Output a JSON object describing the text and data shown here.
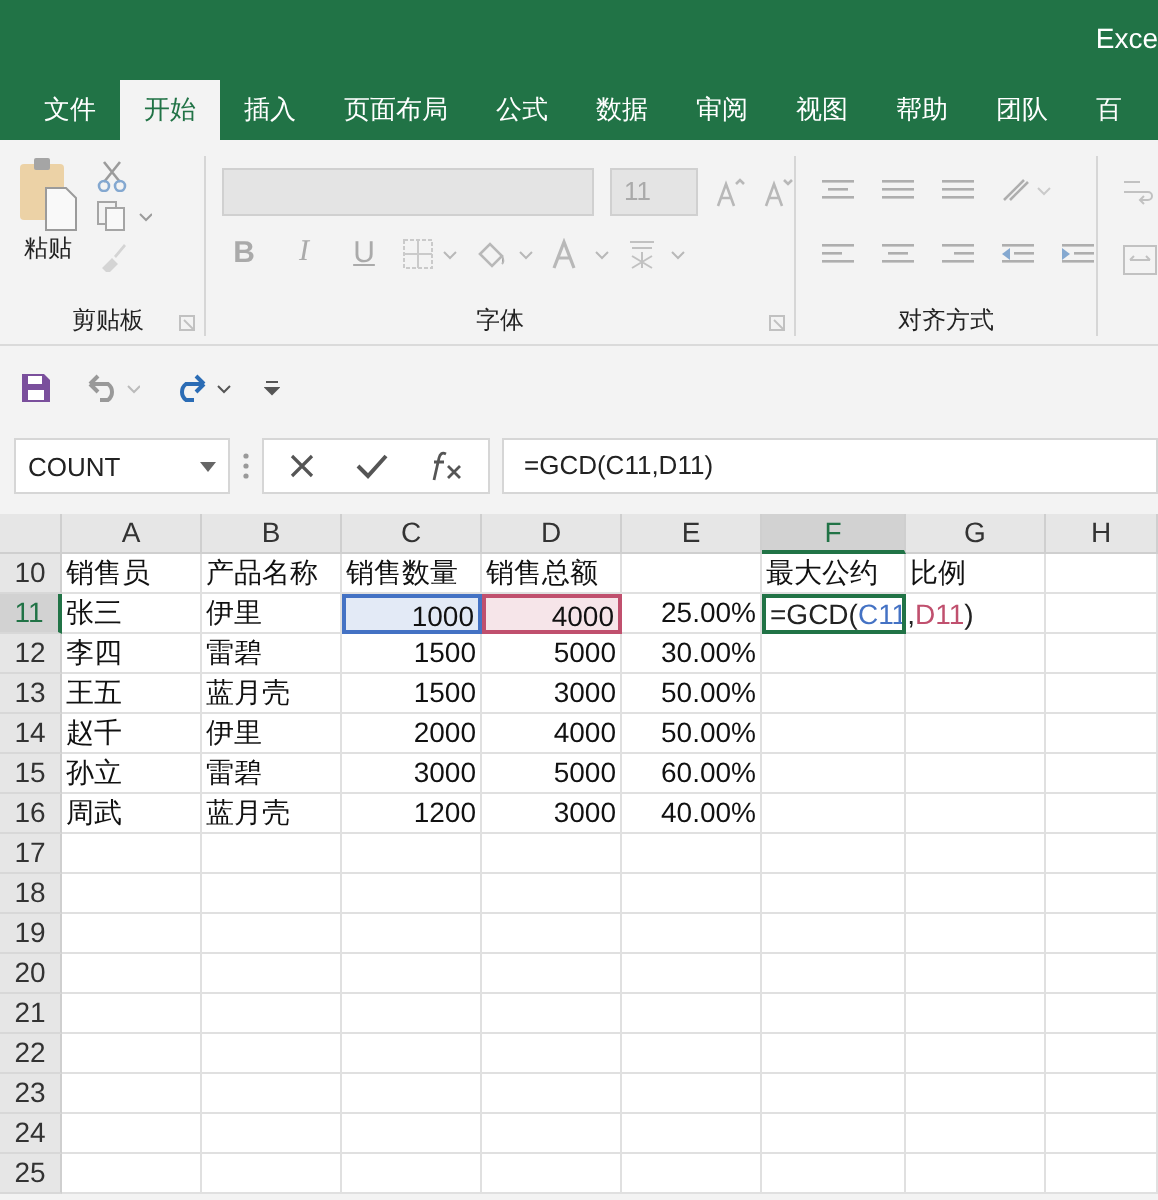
{
  "window": {
    "title": "Exce"
  },
  "tabs": [
    {
      "label": "文件",
      "selected": false
    },
    {
      "label": "开始",
      "selected": true
    },
    {
      "label": "插入",
      "selected": false
    },
    {
      "label": "页面布局",
      "selected": false
    },
    {
      "label": "公式",
      "selected": false
    },
    {
      "label": "数据",
      "selected": false
    },
    {
      "label": "审阅",
      "selected": false
    },
    {
      "label": "视图",
      "selected": false
    },
    {
      "label": "帮助",
      "selected": false
    },
    {
      "label": "团队",
      "selected": false
    },
    {
      "label": "百",
      "selected": false
    }
  ],
  "ribbon": {
    "disabled": true,
    "groups": [
      {
        "kind": "clipboard",
        "label": "剪贴板",
        "paste_label": "粘贴"
      },
      {
        "kind": "font",
        "label": "字体",
        "font_size": "11",
        "buttons": [
          "B",
          "I",
          "U"
        ]
      },
      {
        "kind": "alignment",
        "label": "对齐方式"
      }
    ]
  },
  "formula_bar": {
    "name_box": "COUNT",
    "formula": "=GCD(C11,D11)"
  },
  "sheet": {
    "columns": [
      {
        "label": "A",
        "selected": false
      },
      {
        "label": "B",
        "selected": false
      },
      {
        "label": "C",
        "selected": false
      },
      {
        "label": "D",
        "selected": false
      },
      {
        "label": "E",
        "selected": false
      },
      {
        "label": "F",
        "selected": true
      },
      {
        "label": "G",
        "selected": false
      },
      {
        "label": "H",
        "selected": false
      }
    ],
    "rows": [
      {
        "number": "10",
        "selected": false,
        "cells": [
          {
            "text": "销售员"
          },
          {
            "text": "产品名称"
          },
          {
            "text": "销售数量"
          },
          {
            "text": "销售总额"
          },
          null,
          {
            "text": "最大公约"
          },
          {
            "text": "比例"
          },
          null
        ]
      },
      {
        "number": "11",
        "selected": true,
        "cells": [
          {
            "text": "张三"
          },
          {
            "text": "伊里"
          },
          {
            "text": "1000",
            "kind": "number",
            "color": "#4472c4"
          },
          {
            "text": "4000",
            "kind": "number",
            "color": "#c0506e"
          },
          {
            "text": "25.00%",
            "kind": "number"
          },
          {
            "active": true,
            "text": "=GCD(C11,D11)",
            "references": [
              {
                "color": "#4472c4"
              },
              {
                "color": "#c0506e"
              }
            ]
          },
          null,
          null
        ]
      },
      {
        "number": "12",
        "selected": false,
        "cells": [
          {
            "text": "李四"
          },
          {
            "text": "雷碧"
          },
          {
            "text": "1500",
            "kind": "number"
          },
          {
            "text": "5000",
            "kind": "number"
          },
          {
            "text": "30.00%",
            "kind": "number"
          },
          null,
          null,
          null
        ]
      },
      {
        "number": "13",
        "selected": false,
        "cells": [
          {
            "text": "王五"
          },
          {
            "text": "蓝月壳"
          },
          {
            "text": "1500",
            "kind": "number"
          },
          {
            "text": "3000",
            "kind": "number"
          },
          {
            "text": "50.00%",
            "kind": "number"
          },
          null,
          null,
          null
        ]
      },
      {
        "number": "14",
        "selected": false,
        "cells": [
          {
            "text": "赵千"
          },
          {
            "text": "伊里"
          },
          {
            "text": "2000",
            "kind": "number"
          },
          {
            "text": "4000",
            "kind": "number"
          },
          {
            "text": "50.00%",
            "kind": "number"
          },
          null,
          null,
          null
        ]
      },
      {
        "number": "15",
        "selected": false,
        "cells": [
          {
            "text": "孙立"
          },
          {
            "text": "雷碧"
          },
          {
            "text": "3000",
            "kind": "number"
          },
          {
            "text": "5000",
            "kind": "number"
          },
          {
            "text": "60.00%",
            "kind": "number"
          },
          null,
          null,
          null
        ]
      },
      {
        "number": "16",
        "selected": false,
        "cells": [
          {
            "text": "周武"
          },
          {
            "text": "蓝月壳"
          },
          {
            "text": "1200",
            "kind": "number"
          },
          {
            "text": "3000",
            "kind": "number"
          },
          {
            "text": "40.00%",
            "kind": "number"
          },
          null,
          null,
          null
        ]
      },
      {
        "number": "17",
        "selected": false
      },
      {
        "number": "18",
        "selected": false
      },
      {
        "number": "19",
        "selected": false
      },
      {
        "number": "20",
        "selected": false
      },
      {
        "number": "21",
        "selected": false
      },
      {
        "number": "22",
        "selected": false
      },
      {
        "number": "23",
        "selected": false
      },
      {
        "number": "24",
        "selected": false
      },
      {
        "number": "25",
        "selected": false
      }
    ]
  }
}
